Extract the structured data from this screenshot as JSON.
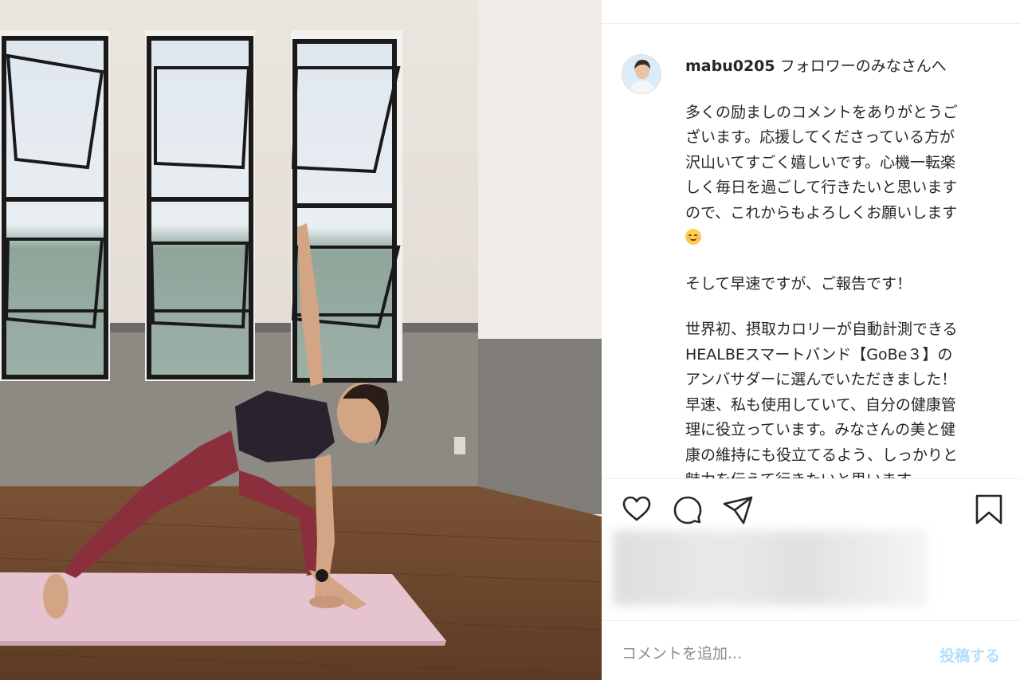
{
  "post": {
    "username": "mabu0205",
    "caption_lines": [
      {
        "text": "フォロワーのみなさんへ",
        "with_user": true
      },
      {
        "text": "",
        "blank": true
      },
      {
        "text": "多くの励ましのコメントをありがとうご"
      },
      {
        "text": "ざいます。応援してくださっている方が"
      },
      {
        "text": "沢山いてすごく嬉しいです。心機一転楽"
      },
      {
        "text": "しく毎日を過ごして行きたいと思います"
      },
      {
        "text": "ので、これからもよろしくお願いします"
      },
      {
        "text": "",
        "emoji": "relieved-face"
      },
      {
        "text": "",
        "blank": true
      },
      {
        "text": "そして早速ですが、ご報告です！"
      },
      {
        "text": "",
        "blank": true
      },
      {
        "text": "世界初、摂取カロリーが自動計測できる"
      },
      {
        "text": "HEALBEスマートバンド【GoBe３】の"
      },
      {
        "text": "アンバサダーに選んでいただきました！"
      },
      {
        "text": "早速、私も使用していて、自分の健康管"
      },
      {
        "text": "理に役立っています。みなさんの美と健"
      },
      {
        "text": "康の維持にも役立てるよう、しっかりと"
      },
      {
        "text": "魅力を伝えて行きたいと思います。"
      }
    ]
  },
  "actions": {
    "like_icon": "heart-icon",
    "comment_icon": "comment-bubble-icon",
    "share_icon": "paper-plane-icon",
    "save_icon": "bookmark-icon"
  },
  "comment": {
    "placeholder": "コメントを追加...",
    "post_label": "投稿する"
  },
  "colors": {
    "post_button_disabled": "#b2dffc",
    "text_primary": "#262626",
    "placeholder": "#8e8e8e"
  }
}
